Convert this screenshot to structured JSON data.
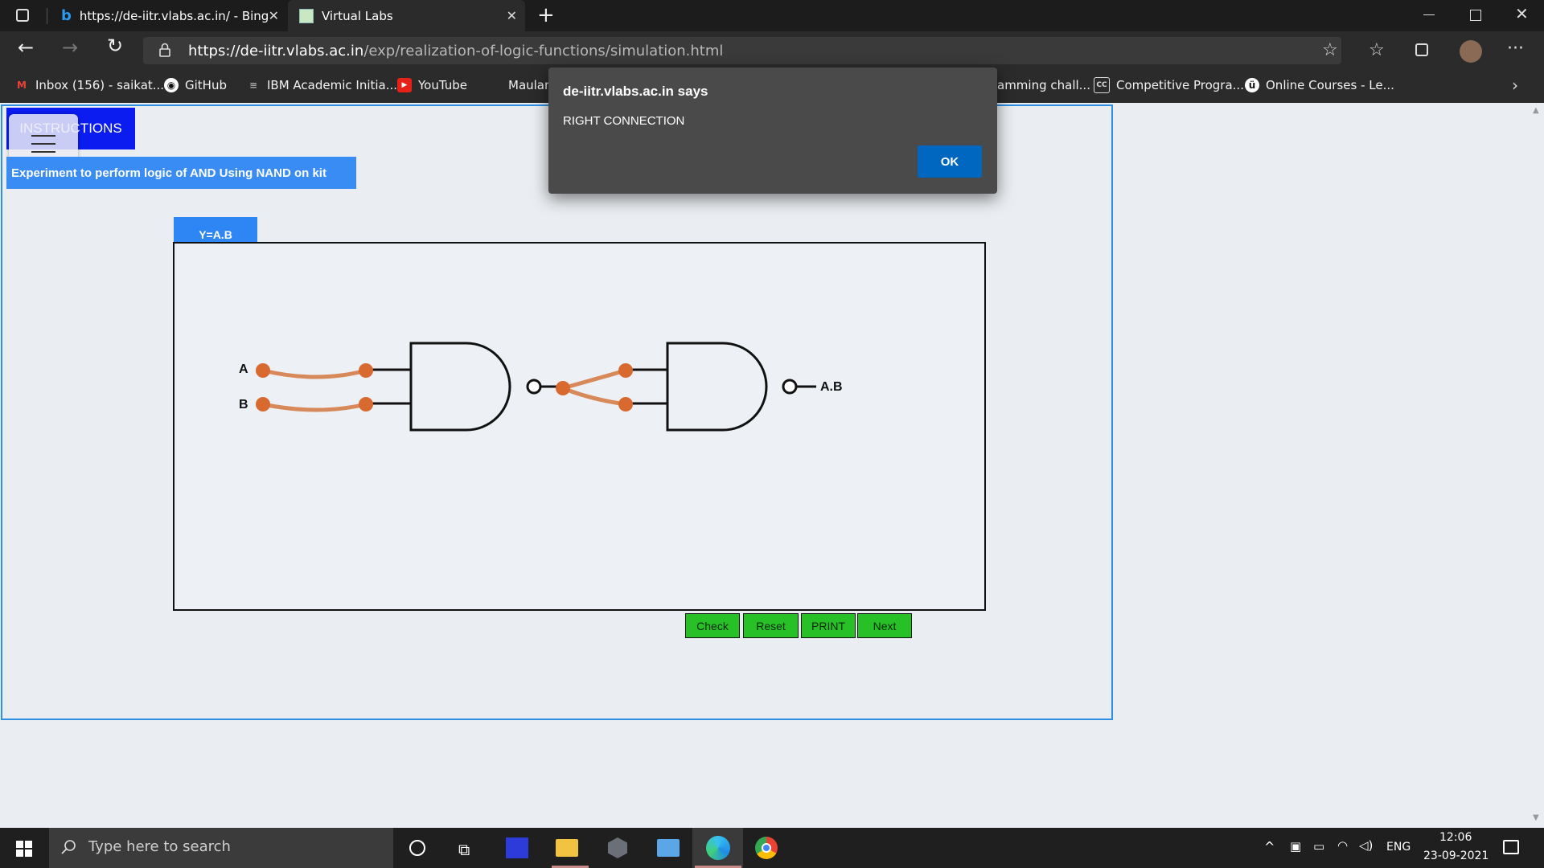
{
  "browser": {
    "tabs": [
      {
        "title": "https://de-iitr.vlabs.ac.in/ - Bing",
        "active": false,
        "icon": "bing-icon"
      },
      {
        "title": "Virtual Labs",
        "active": true,
        "icon": "vlabs-favicon"
      }
    ],
    "new_tab_symbol": "+",
    "url": {
      "host": "https://de-iitr.vlabs.ac.in",
      "path": "/exp/realization-of-logic-functions/simulation.html"
    },
    "bookmarks": [
      {
        "label": "Inbox (156) - saikat...",
        "icon": "gmail-icon"
      },
      {
        "label": "GitHub",
        "icon": "github-icon"
      },
      {
        "label": "IBM Academic Initia...",
        "icon": "ibm-icon"
      },
      {
        "label": "YouTube",
        "icon": "youtube-icon"
      },
      {
        "label": "Maulan",
        "icon": ""
      },
      {
        "label": "amming chall...",
        "icon": ""
      },
      {
        "label": "Competitive Progra...",
        "icon": "cc-icon"
      },
      {
        "label": "Online Courses - Le...",
        "icon": "udemy-icon"
      }
    ]
  },
  "dialog": {
    "title": "de-iitr.vlabs.ac.in says",
    "message": "RIGHT CONNECTION",
    "ok_label": "OK"
  },
  "lab": {
    "instructions_label": "INSTRUCTIONS",
    "experiment_title": "Experiment to perform logic of AND Using NAND on kit",
    "equation": "Y=A.B",
    "input_a": "A",
    "input_b": "B",
    "output_label": "A.B",
    "buttons": [
      "Check",
      "Reset",
      "PRINT",
      "Next"
    ]
  },
  "taskbar": {
    "search_placeholder": "Type here to search",
    "language": "ENG",
    "time": "12:06",
    "date": "23-09-2021"
  },
  "colors": {
    "accent_blue": "#0a1cf0",
    "title_blue": "#3a8cf5",
    "button_green": "#27c027",
    "wire_orange": "#d8895a",
    "dialog_ok": "#0067c0"
  }
}
